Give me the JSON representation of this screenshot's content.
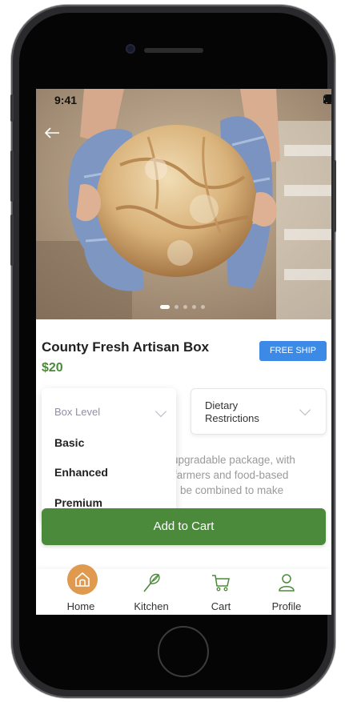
{
  "status_bar": {
    "time": "9:41"
  },
  "product": {
    "title": "County Fresh Artisan Box",
    "price": "$20",
    "badge": "FREE SHIP"
  },
  "box_level": {
    "label": "Box Level",
    "options": [
      "Basic",
      "Enhanced",
      "Premium"
    ]
  },
  "dietary": {
    "label_line1": "Dietary",
    "label_line2": "Restrictions"
  },
  "description_lines": [
    "upgradable package, with",
    "farmers and food-based",
    "be combined to make"
  ],
  "add_to_cart": "Add to Cart",
  "tabs": [
    {
      "label": "Home",
      "icon": "home-icon"
    },
    {
      "label": "Kitchen",
      "icon": "whisk-icon"
    },
    {
      "label": "Cart",
      "icon": "cart-icon"
    },
    {
      "label": "Profile",
      "icon": "profile-icon"
    }
  ],
  "colors": {
    "accent_green": "#4a8a3a",
    "badge_blue": "#3d8ae6",
    "home_orange": "#e09a50"
  },
  "carousel": {
    "slides": 5,
    "active": 1
  }
}
